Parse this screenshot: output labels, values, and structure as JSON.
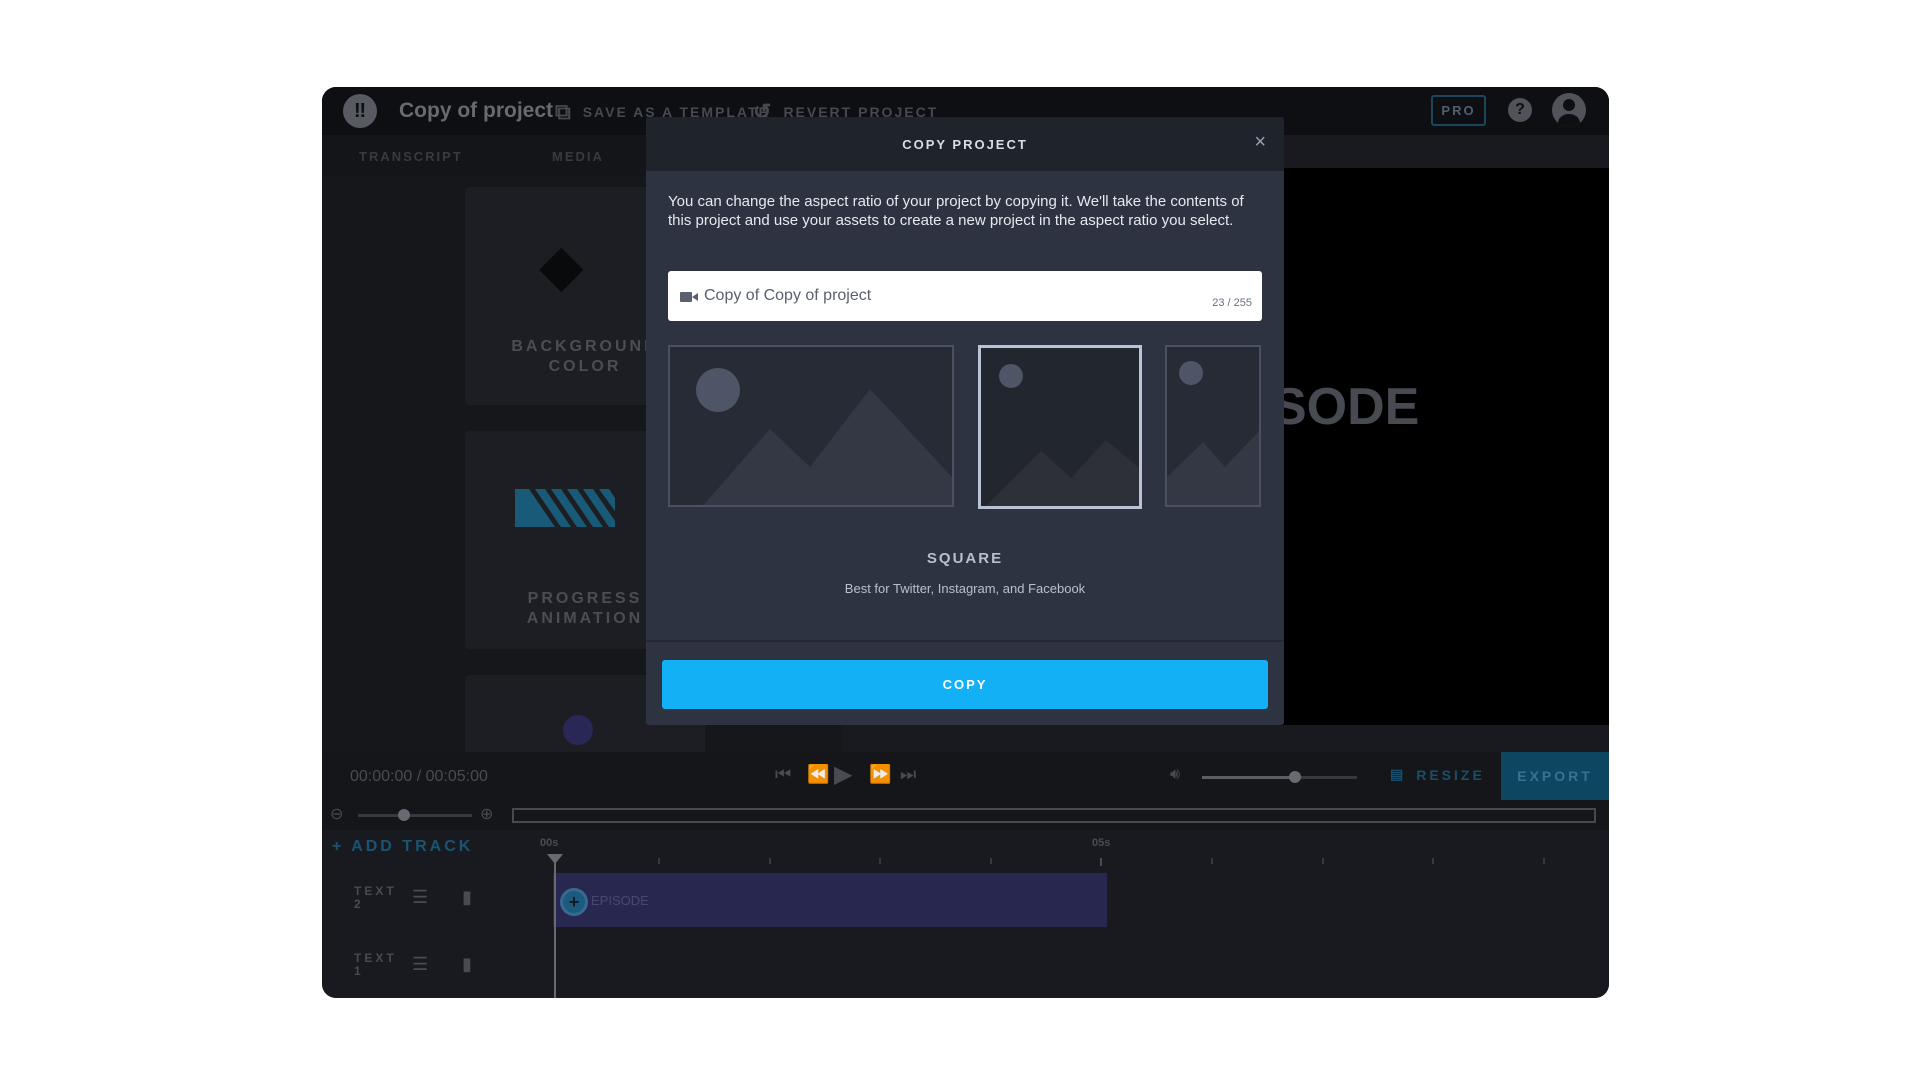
{
  "app": {
    "project_title": "Copy of project",
    "logo_glyph": "‼",
    "save_template_label": "SAVE AS A TEMPLATE",
    "revert_label": "REVERT PROJECT",
    "pro_label": "PRO",
    "help_glyph": "?"
  },
  "left_panel": {
    "tabs": [
      "TRANSCRIPT",
      "MEDIA"
    ],
    "cards": [
      {
        "label_line1": "BACKGROUND",
        "label_line2": "COLOR"
      },
      {
        "label_line1": "PROGRESS",
        "label_line2": "ANIMATION"
      }
    ]
  },
  "preview": {
    "visible_text": "SODE"
  },
  "transport": {
    "time": "00:00:00 / 00:05:00",
    "resize_label": "RESIZE",
    "export_label": "EXPORT",
    "volume": 0.6
  },
  "timeline": {
    "add_track_label": "+ ADD TRACK",
    "ruler_labels": [
      "00s",
      "05s"
    ],
    "tracks": [
      {
        "name_line1": "TEXT",
        "name_line2": "2"
      },
      {
        "name_line1": "TEXT",
        "name_line2": "1"
      }
    ],
    "clip_label": "EPISODE"
  },
  "modal": {
    "title": "COPY PROJECT",
    "close_glyph": "×",
    "description": "You can change the aspect ratio of your project by copying it. We'll take the contents of this project and use your assets to create a new project in the aspect ratio you select.",
    "name_value": "Copy of Copy of project",
    "char_count": "23 / 255",
    "ratio_options": [
      "landscape",
      "square",
      "portrait"
    ],
    "selected_ratio": "square",
    "selected_name": "SQUARE",
    "selected_desc": "Best for Twitter, Instagram, and Facebook",
    "copy_label": "COPY"
  },
  "colors": {
    "accent": "#14b0f5",
    "modal_bg": "#2d3340",
    "clip": "#2b2a55"
  }
}
